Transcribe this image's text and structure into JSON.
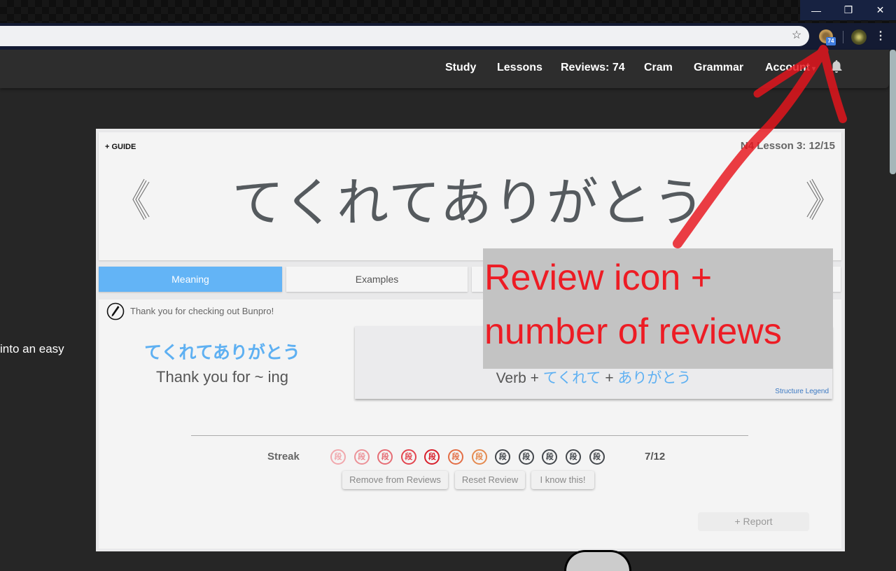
{
  "window_controls": {
    "minimize": "—",
    "restore": "❐",
    "close": "✕"
  },
  "browser": {
    "bookmark_icon": "☆",
    "extension": {
      "name": "review-icon",
      "badge": "74",
      "badge_color": "#3f7de0"
    },
    "menu_icon": "⋮"
  },
  "nav": {
    "links": [
      "Study",
      "Lessons",
      "Reviews: 74",
      "Cram",
      "Grammar",
      "Account"
    ],
    "account_caret": "▾",
    "bell_icon": "🔔"
  },
  "background_text": "into an easy",
  "card": {
    "guide_label": "+ GUIDE",
    "lesson_progress": "N4 Lesson 3: 12/15",
    "prev_icon": "《",
    "next_icon": "》",
    "grammar_point": "てくれてありがとう",
    "tabs": [
      {
        "label": "Meaning",
        "active": true
      },
      {
        "label": "Examples",
        "active": false
      },
      {
        "label": "",
        "active": false
      }
    ],
    "tab_active_color": "#63b4f6",
    "note": "Thank you for checking out Bunpro!",
    "meaning_jp": "てくれてありがとう",
    "meaning_en": "Thank you for ~ ing",
    "structure": {
      "parts": [
        "Verb",
        "+",
        "てくれて",
        "+",
        "ありがとう"
      ],
      "legend_link": "Structure Legend"
    },
    "streak": {
      "label": "Streak",
      "glyph": "段",
      "stamps": [
        {
          "level": 1,
          "color": "#f1a8ad"
        },
        {
          "level": 2,
          "color": "#ec9298"
        },
        {
          "level": 3,
          "color": "#e66d75"
        },
        {
          "level": 4,
          "color": "#e3454f"
        },
        {
          "level": 5,
          "color": "#d8202c"
        },
        {
          "level": 6,
          "color": "#e36e46"
        },
        {
          "level": 7,
          "color": "#e58a4f"
        },
        {
          "level": 8,
          "color": "#44484d"
        },
        {
          "level": 9,
          "color": "#44484d"
        },
        {
          "level": 10,
          "color": "#44484d"
        },
        {
          "level": 11,
          "color": "#44484d"
        },
        {
          "level": 12,
          "color": "#44484d"
        }
      ],
      "count": "7/12"
    },
    "buttons": {
      "remove": "Remove from Reviews",
      "reset": "Reset Review",
      "know": "I know this!"
    },
    "report": "+ Report"
  },
  "annotation": {
    "line1": "Review icon +",
    "line2": "number of reviews",
    "color": "#ed1c24"
  }
}
